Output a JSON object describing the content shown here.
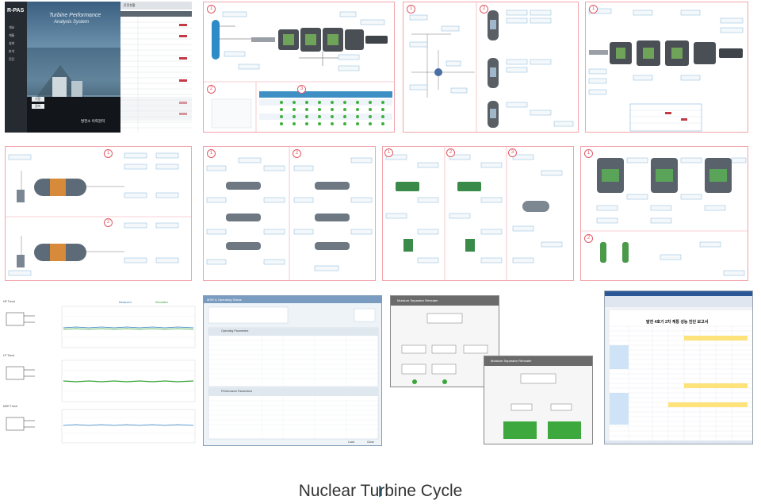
{
  "caption": "Nuclear Turbine Cycle",
  "rpas": {
    "logo": "R-PAS",
    "menu": [
      "개요",
      "계통",
      "설비",
      "분석",
      "진단"
    ],
    "hero_line1": "Turbine Performance",
    "hero_line2": "Analysis System",
    "buttons": [
      "기동",
      "정지",
      "제어"
    ],
    "footer_title": "발전소 이력관리",
    "table_title": "운전현황"
  },
  "pws": {
    "title": "MSR & Operating Status",
    "section1": "Operating Parameters",
    "section2": "Performance Parameters",
    "buttons": [
      "Load",
      "Save",
      "Close"
    ]
  },
  "pcycle": {
    "title": "Moisture Separator Reheater",
    "title2": "Moisture Separator Reheater"
  },
  "excel": {
    "title": "발전 4호기 2차 계통 성능 진단 보고서"
  },
  "trend": {
    "labels": [
      "HP Trend",
      "LP Trend",
      "MSR Trend"
    ],
    "legend": [
      "Measured",
      "Simulated"
    ]
  },
  "colors": {
    "accent": "#1a8fb0",
    "pink_border": "#f2a4aa",
    "green": "#3aa63a"
  }
}
